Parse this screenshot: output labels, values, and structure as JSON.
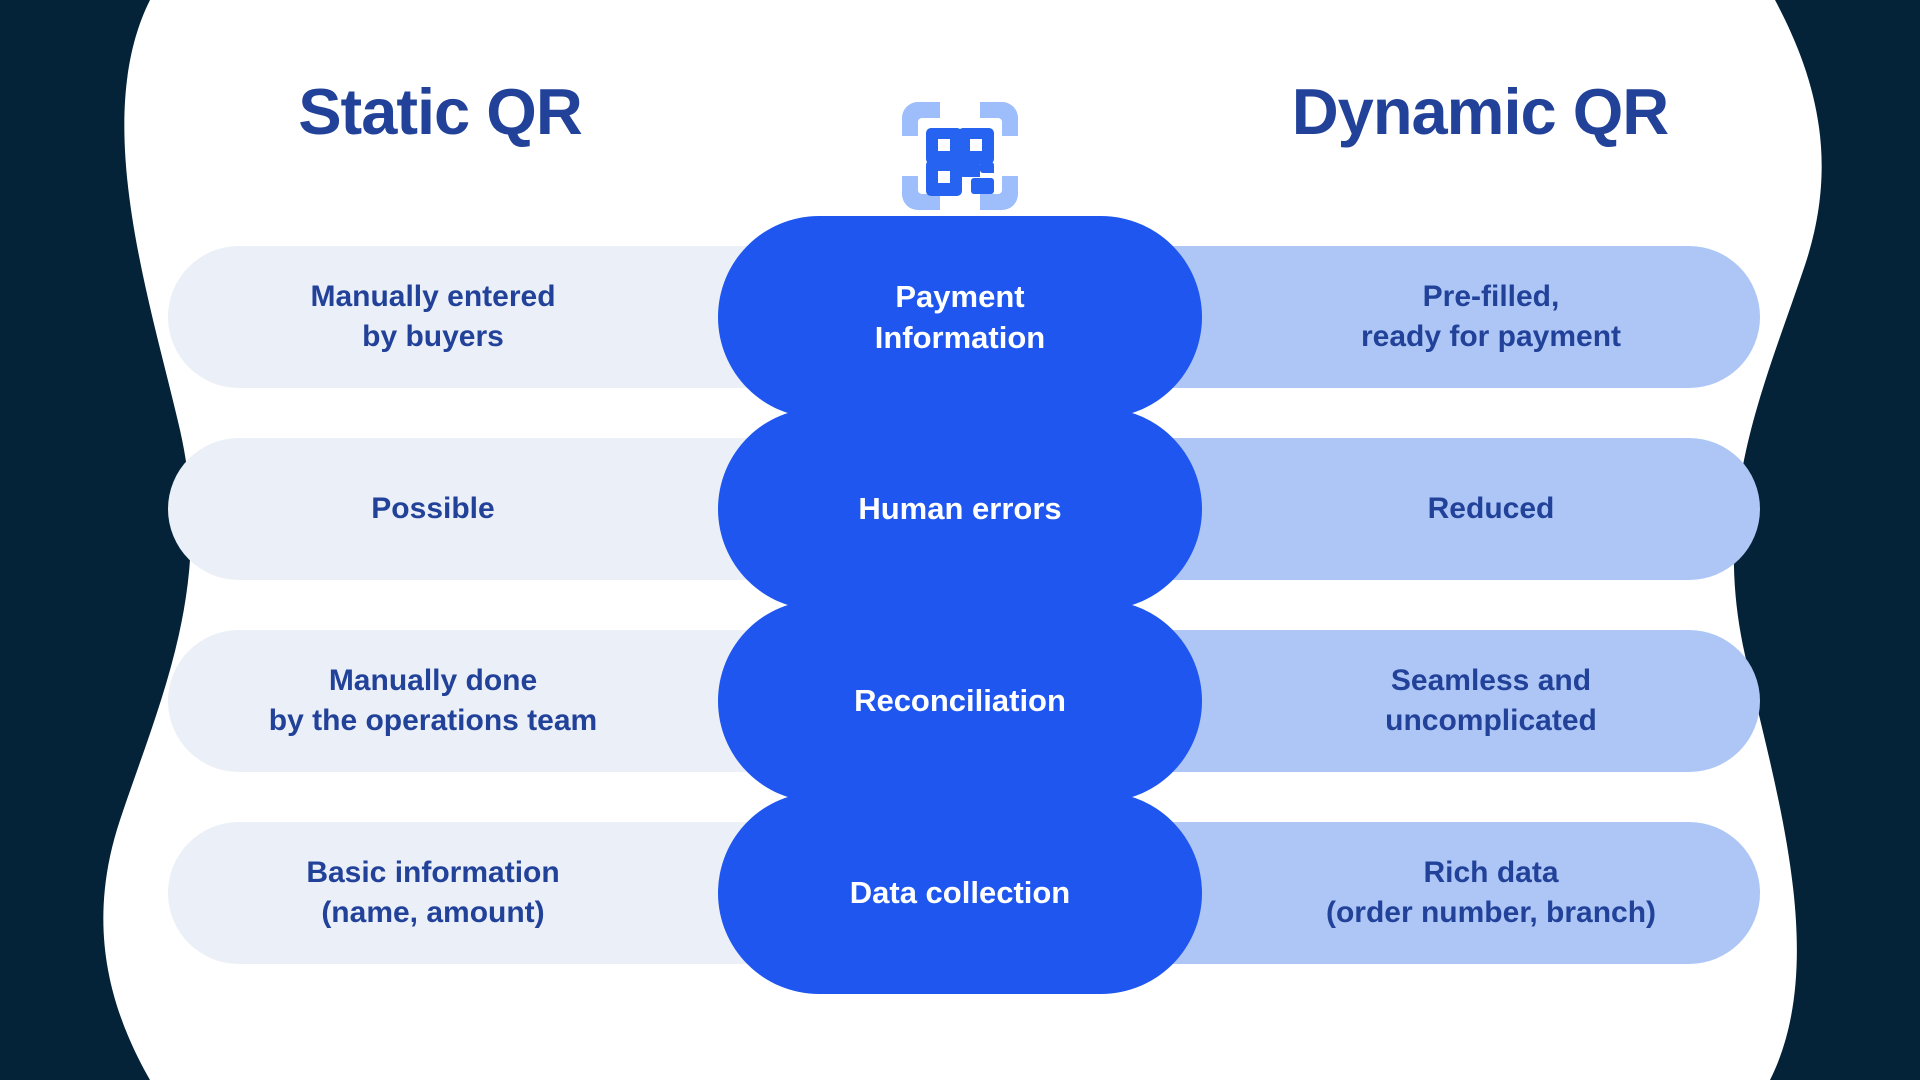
{
  "page": {
    "background_dark": "#042338",
    "panel_background": "#ffffff",
    "accent_blue": "#1e56ef",
    "left_bar_color": "#eaeff8",
    "right_bar_color": "#aec6f5",
    "heading_color": "#22429a"
  },
  "header": {
    "left_title": "Static QR",
    "right_title": "Dynamic QR",
    "icon": "qr-code-scan-icon"
  },
  "rows": [
    {
      "center_label": "Payment\nInformation",
      "left_value": "Manually entered\nby buyers",
      "right_value": "Pre-filled,\nready for payment"
    },
    {
      "center_label": "Human errors",
      "left_value": "Possible",
      "right_value": "Reduced"
    },
    {
      "center_label": "Reconciliation",
      "left_value": "Manually done\nby the operations team",
      "right_value": "Seamless and\nuncomplicated"
    },
    {
      "center_label": "Data collection",
      "left_value": "Basic information\n(name, amount)",
      "right_value": "Rich data\n(order number, branch)"
    }
  ]
}
